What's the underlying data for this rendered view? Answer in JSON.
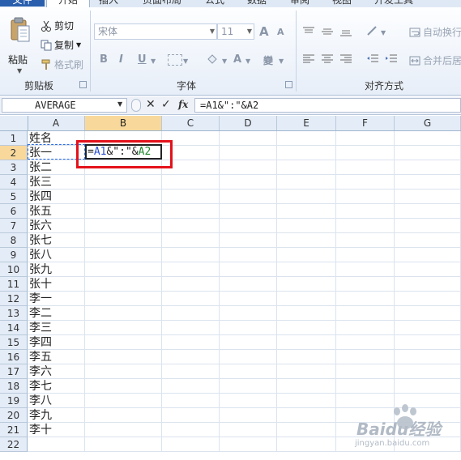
{
  "ribbon": {
    "tabs": [
      {
        "label": "文件"
      },
      {
        "label": "开始"
      },
      {
        "label": "插入"
      },
      {
        "label": "页面布局"
      },
      {
        "label": "公式"
      },
      {
        "label": "数据"
      },
      {
        "label": "审阅"
      },
      {
        "label": "视图"
      },
      {
        "label": "开发工具"
      }
    ],
    "clipboard": {
      "paste": "粘贴",
      "cut": "剪切",
      "copy": "复制",
      "format_painter": "格式刷",
      "group": "剪贴板"
    },
    "font": {
      "font_name": "宋体",
      "font_size": "11",
      "bold": "B",
      "italic": "I",
      "underline": "U",
      "grow": "A",
      "shrink": "A",
      "font_color": "A",
      "group": "字体"
    },
    "alignment": {
      "wrap_text": "自动换行",
      "merge_center": "合并后居",
      "group": "对齐方式"
    }
  },
  "formula_bar": {
    "name_box": "AVERAGE",
    "cancel": "✕",
    "enter": "✓",
    "fx": "fx",
    "formula": "=A1&\":\"&A2"
  },
  "sheet": {
    "columns": [
      "A",
      "B",
      "C",
      "D",
      "E",
      "F",
      "G"
    ],
    "rows": [
      "1",
      "2",
      "3",
      "4",
      "5",
      "6",
      "7",
      "8",
      "9",
      "10",
      "11",
      "12",
      "13",
      "14",
      "15",
      "16",
      "17",
      "18",
      "19",
      "20",
      "21",
      "22"
    ],
    "col_a": [
      "姓名",
      "张一",
      "张二",
      "张三",
      "张四",
      "张五",
      "张六",
      "张七",
      "张八",
      "张九",
      "张十",
      "李一",
      "李二",
      "李三",
      "李四",
      "李五",
      "李六",
      "李七",
      "李八",
      "李九",
      "李十",
      ""
    ],
    "active_cell_tokens": [
      "=",
      "A1",
      "&\":\"&",
      "A2"
    ]
  },
  "watermark": {
    "text": "Baidu经验",
    "url": "jingyan.baidu.com"
  },
  "colors": {
    "file_tab": "#2a5fad",
    "selected_header": "#f9d99b",
    "highlight_box": "#e3121b",
    "ref_blue": "#2b50d0",
    "ref_green": "#1d8a2d"
  }
}
